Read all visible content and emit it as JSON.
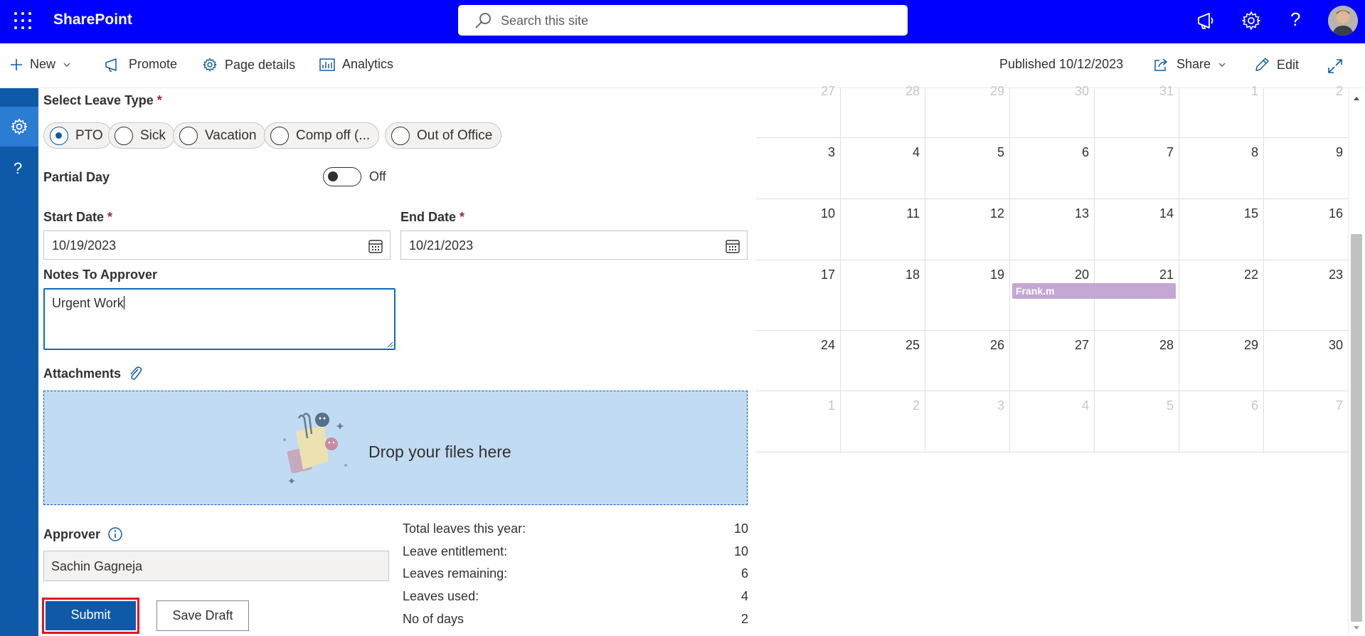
{
  "suite": {
    "brand": "SharePoint",
    "search_placeholder": "Search this site"
  },
  "command_bar": {
    "new": "New",
    "promote": "Promote",
    "page_details": "Page details",
    "analytics": "Analytics",
    "published": "Published 10/12/2023",
    "share": "Share",
    "edit": "Edit"
  },
  "form": {
    "leave_type_label": "Select Leave Type",
    "required_mark": "*",
    "leave_types": [
      "PTO",
      "Sick",
      "Vacation",
      "Comp off (...",
      "Out of Office"
    ],
    "selected_leave_type": "PTO",
    "partial_day_label": "Partial Day",
    "partial_day_state": "Off",
    "start_date_label": "Start Date",
    "start_date": "10/19/2023",
    "end_date_label": "End Date",
    "end_date": "10/21/2023",
    "notes_label": "Notes To Approver",
    "notes_value": "Urgent Work",
    "attachments_label": "Attachments",
    "drop_text": "Drop your files here",
    "approver_label": "Approver",
    "approver_value": "Sachin  Gagneja",
    "submit": "Submit",
    "save_draft": "Save Draft"
  },
  "stats": [
    {
      "label": "Total leaves this year:",
      "value": "10"
    },
    {
      "label": "Leave entitlement:",
      "value": "10"
    },
    {
      "label": "Leaves remaining:",
      "value": "6"
    },
    {
      "label": "Leaves used:",
      "value": "4"
    },
    {
      "label": "No of days",
      "value": "2"
    }
  ],
  "calendar": {
    "weeks": [
      [
        "27",
        "28",
        "29",
        "30",
        "31",
        "1",
        "2"
      ],
      [
        "3",
        "4",
        "5",
        "6",
        "7",
        "8",
        "9"
      ],
      [
        "10",
        "11",
        "12",
        "13",
        "14",
        "15",
        "16"
      ],
      [
        "17",
        "18",
        "19",
        "20",
        "21",
        "22",
        "23"
      ],
      [
        "24",
        "25",
        "26",
        "27",
        "28",
        "29",
        "30"
      ],
      [
        "1",
        "2",
        "3",
        "4",
        "5",
        "6",
        "7"
      ]
    ],
    "event": {
      "label": "Frank.m",
      "color": "#c4a7d3"
    }
  },
  "colors": {
    "suite_bar": "#0000ff",
    "rail": "#0f5aa8",
    "accent": "#0f5aa8",
    "drop_zone": "#c0dbf2",
    "submit_outline": "#e81123"
  }
}
